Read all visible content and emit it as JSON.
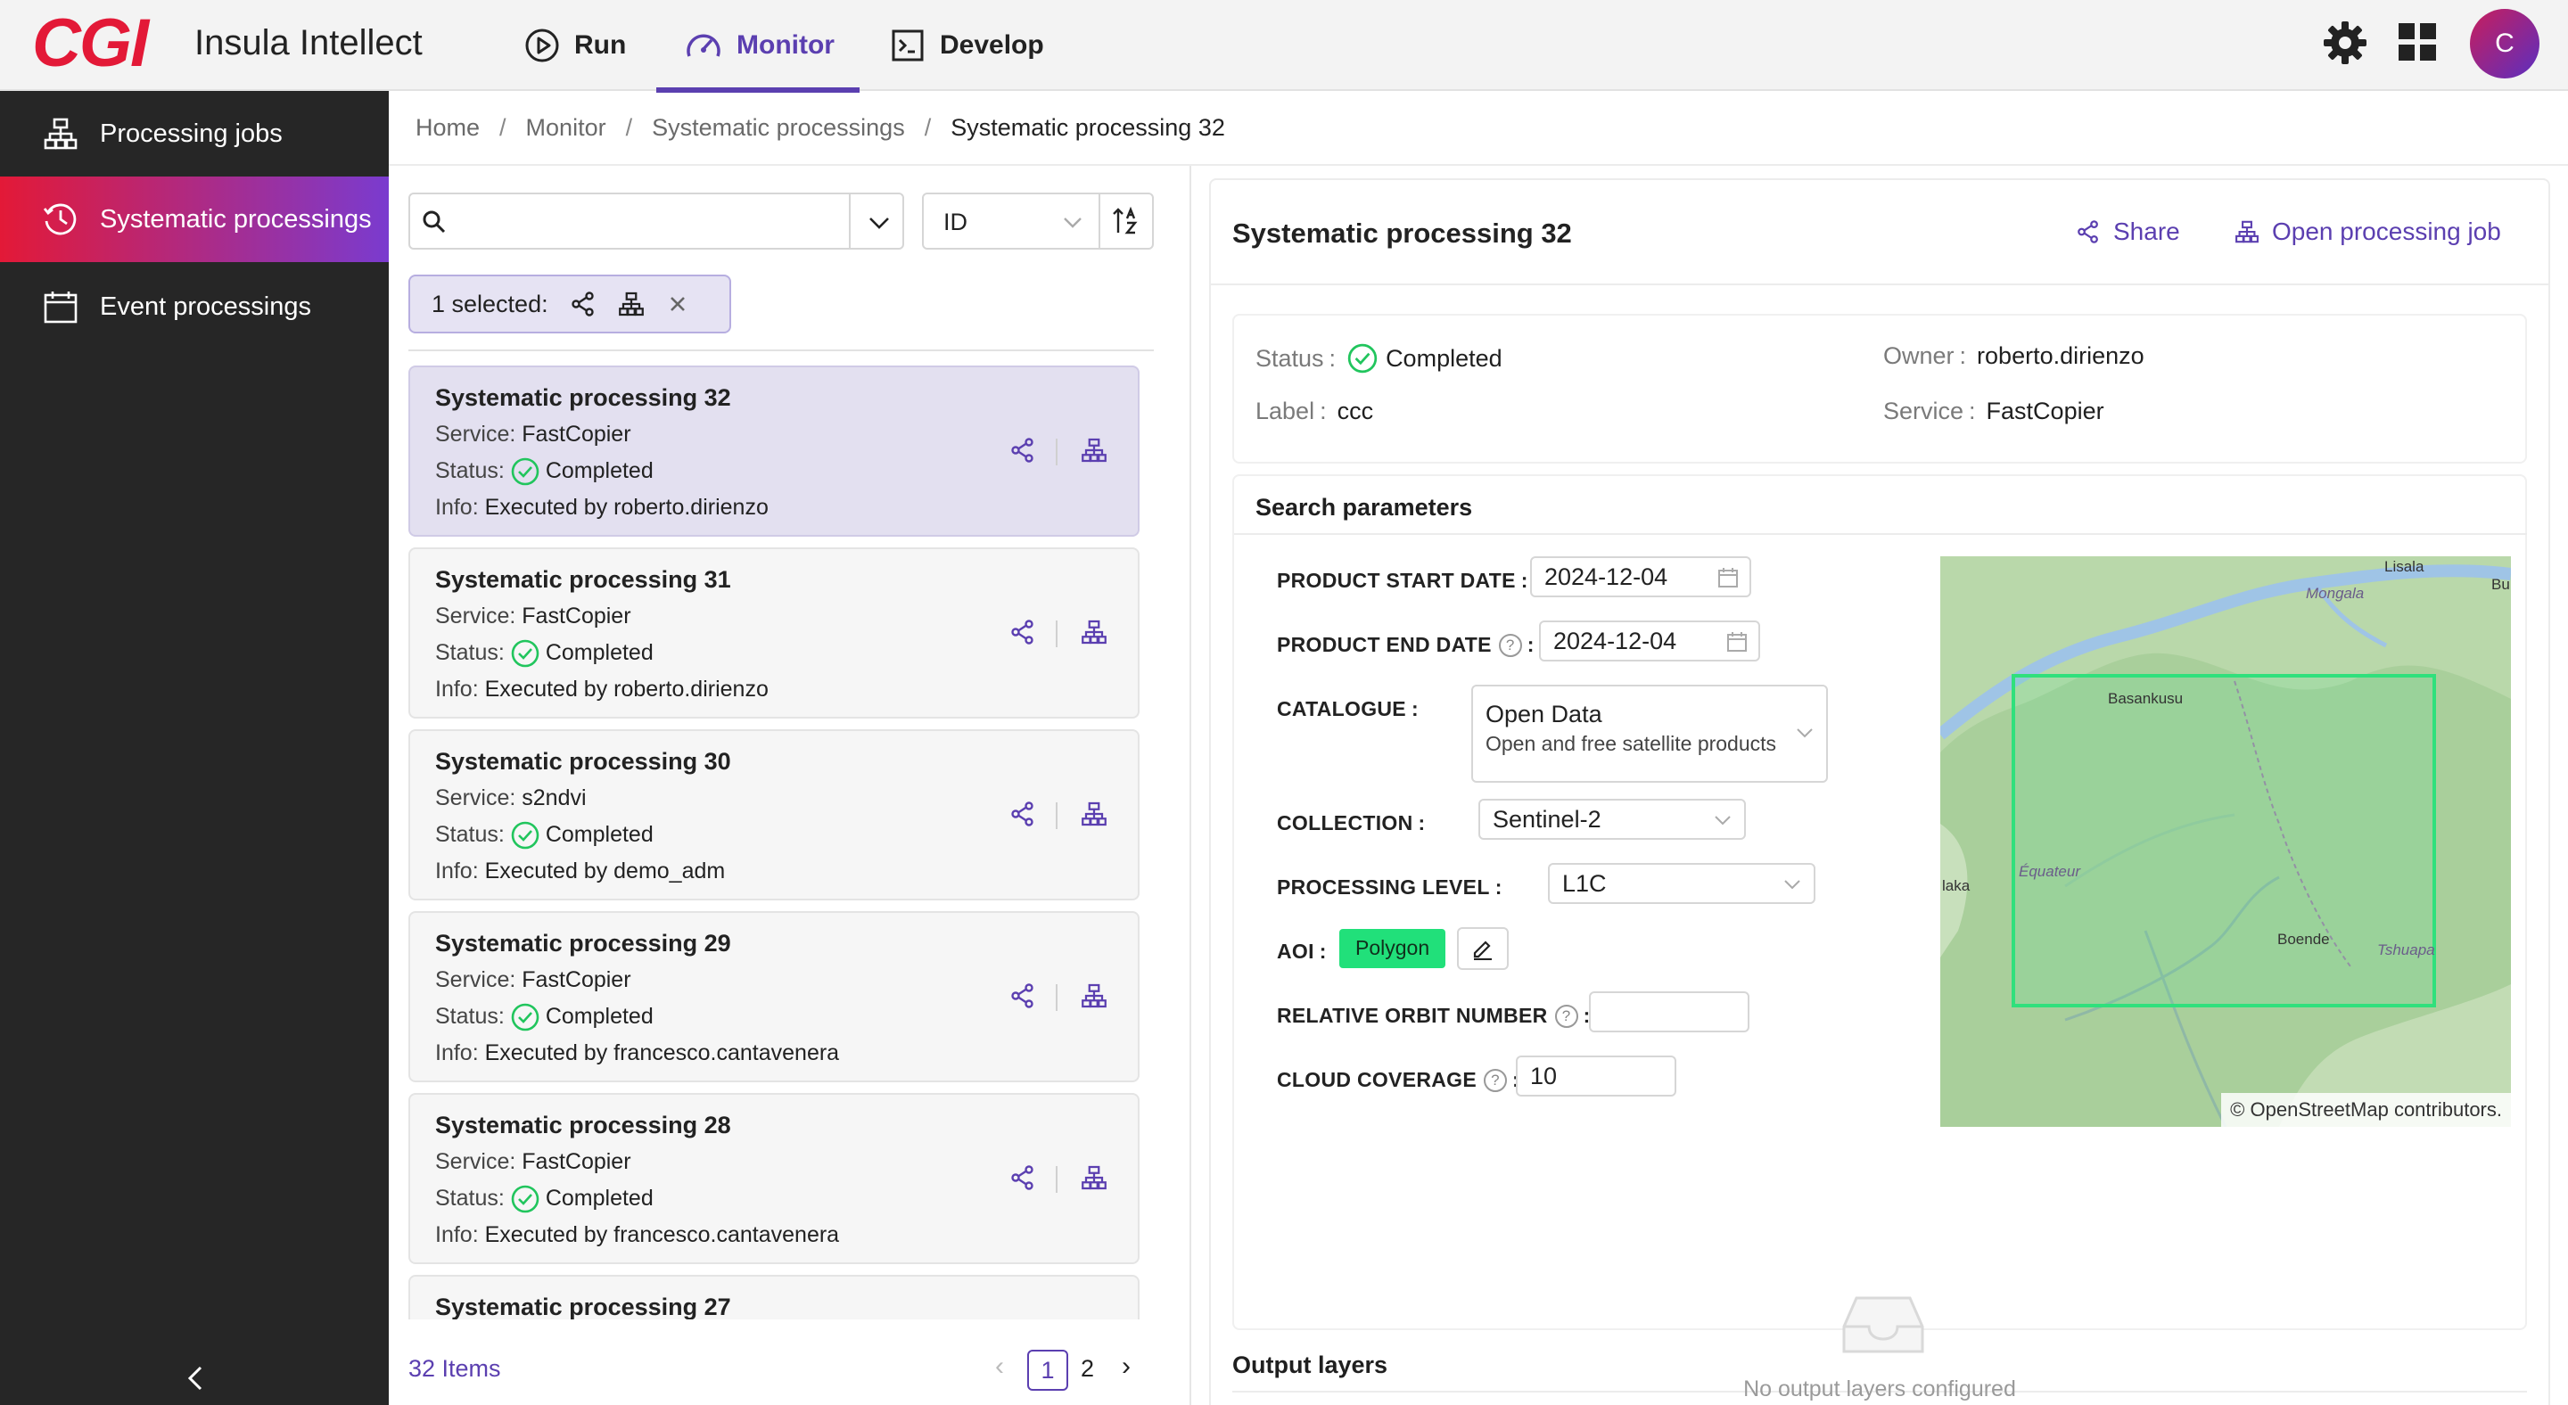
{
  "header": {
    "logo": "CGI",
    "app_title": "Insula Intellect",
    "tabs": [
      {
        "label": "Run",
        "icon": "play-circle-icon"
      },
      {
        "label": "Monitor",
        "icon": "dashboard-gauge-icon",
        "active": true
      },
      {
        "label": "Develop",
        "icon": "terminal-icon"
      }
    ],
    "avatar_initial": "C"
  },
  "sidebar": {
    "items": [
      {
        "label": "Processing jobs",
        "icon": "hierarchy-icon"
      },
      {
        "label": "Systematic processings",
        "icon": "clock-icon",
        "active": true
      },
      {
        "label": "Event processings",
        "icon": "calendar-icon"
      }
    ]
  },
  "breadcrumb": [
    "Home",
    "Monitor",
    "Systematic processings",
    "Systematic processing 32"
  ],
  "list": {
    "search_value": "",
    "sort_field": "ID",
    "selected_label": "1 selected:",
    "items": [
      {
        "title": "Systematic processing 32",
        "service": "FastCopier",
        "status": "Completed",
        "info": "Executed by roberto.dirienzo",
        "selected": true
      },
      {
        "title": "Systematic processing 31",
        "service": "FastCopier",
        "status": "Completed",
        "info": "Executed by roberto.dirienzo"
      },
      {
        "title": "Systematic processing 30",
        "service": "s2ndvi",
        "status": "Completed",
        "info": "Executed by demo_adm"
      },
      {
        "title": "Systematic processing 29",
        "service": "FastCopier",
        "status": "Completed",
        "info": "Executed by francesco.cantavenera"
      },
      {
        "title": "Systematic processing 28",
        "service": "FastCopier",
        "status": "Completed",
        "info": "Executed by francesco.cantavenera"
      },
      {
        "title": "Systematic processing 27",
        "service": "",
        "status": "",
        "info": ""
      }
    ],
    "labels": {
      "service": "Service:",
      "status": "Status:",
      "info": "Info:"
    },
    "footer": {
      "items_count": "32 Items",
      "pages": [
        "1",
        "2"
      ],
      "current_page": "1"
    }
  },
  "detail": {
    "title": "Systematic processing 32",
    "share_label": "Share",
    "open_job_label": "Open processing job",
    "info": {
      "status_label": "Status",
      "status_value": "Completed",
      "label_label": "Label",
      "label_value": "ccc",
      "owner_label": "Owner",
      "owner_value": "roberto.dirienzo",
      "service_label": "Service",
      "service_value": "FastCopier"
    },
    "search_parameters": {
      "title": "Search parameters",
      "product_start_date_label": "PRODUCT START DATE",
      "product_start_date": "2024-12-04",
      "product_end_date_label": "PRODUCT END DATE",
      "product_end_date": "2024-12-04",
      "catalogue_label": "CATALOGUE",
      "catalogue_value": "Open Data",
      "catalogue_sub": "Open and free satellite products",
      "collection_label": "COLLECTION",
      "collection_value": "Sentinel-2",
      "processing_level_label": "PROCESSING LEVEL",
      "processing_level_value": "L1C",
      "aoi_label": "AOI",
      "aoi_value": "Polygon",
      "relative_orbit_label": "RELATIVE ORBIT NUMBER",
      "relative_orbit_value": "",
      "cloud_coverage_label": "CLOUD COVERAGE",
      "cloud_coverage_value": "10"
    },
    "map": {
      "places": [
        "Lisala",
        "Mongala",
        "Bu",
        "Basankusu",
        "Équateur",
        "laka",
        "Boende",
        "Tshuapa"
      ],
      "credits_prefix": "©",
      "credits_link": "OpenStreetMap",
      "credits_suffix": "contributors."
    },
    "output_layers": {
      "title": "Output layers",
      "empty_text": "No output layers configured"
    }
  },
  "colors": {
    "brand_red": "#e31937",
    "accent_purple": "#5b3fb0",
    "success_green": "#21c55d",
    "aoi_green": "#21e07a"
  }
}
